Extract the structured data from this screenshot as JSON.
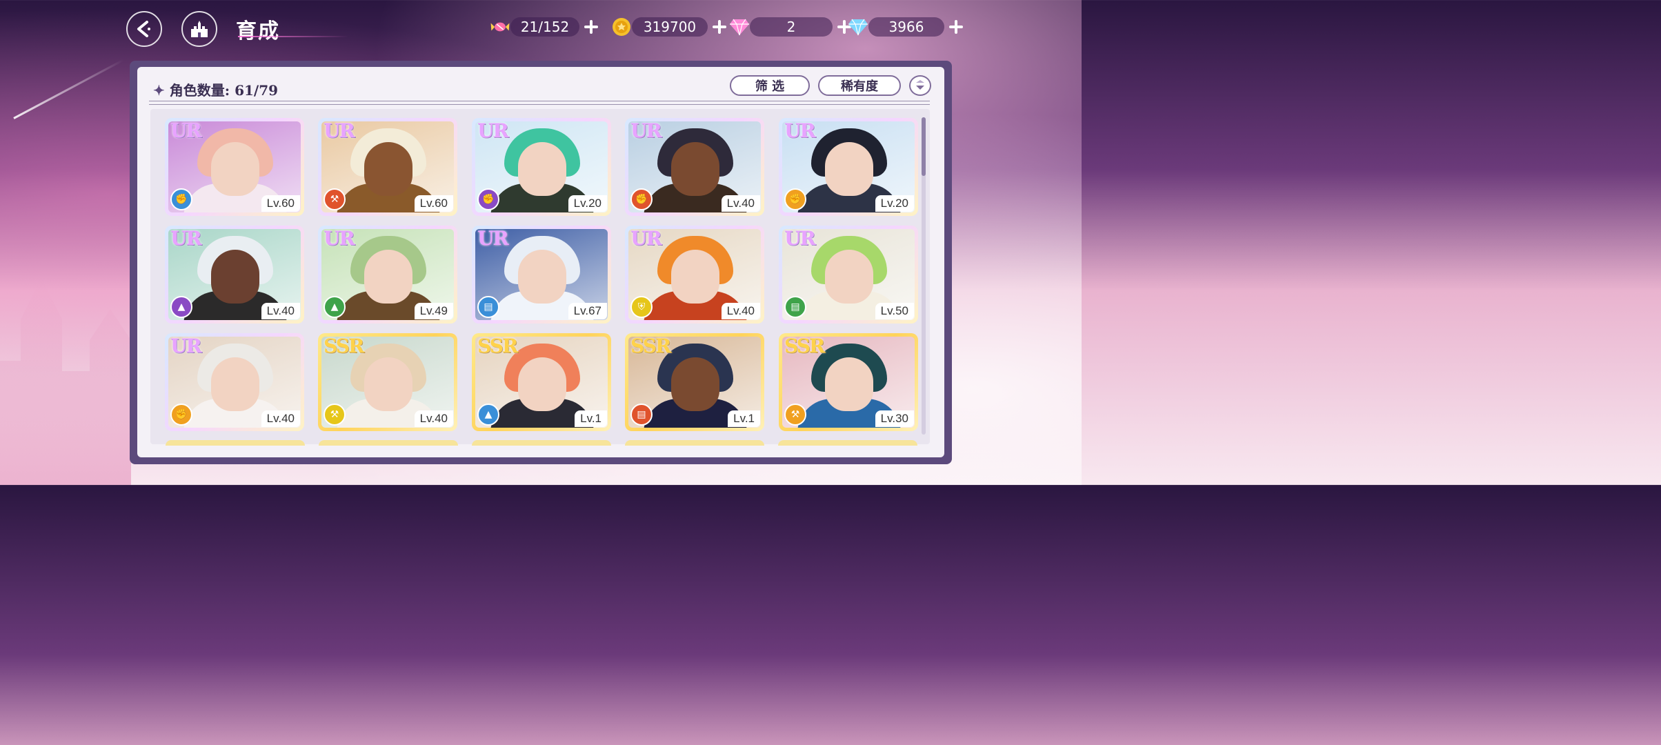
{
  "header": {
    "title": "育成",
    "back_icon": "back-arrow-icon",
    "home_icon": "castle-icon"
  },
  "resources": [
    {
      "name": "candy",
      "icon": "candy-icon",
      "value": "21/152",
      "color": "#ff6fa8"
    },
    {
      "name": "gold",
      "icon": "gold-coin-icon",
      "value": "319700",
      "color": "#f6c12b"
    },
    {
      "name": "gem-pink",
      "icon": "pink-diamond-icon",
      "value": "2",
      "color": "#ff7fd6"
    },
    {
      "name": "gem-blue",
      "icon": "blue-diamond-icon",
      "value": "3966",
      "color": "#7fd8ff"
    }
  ],
  "panel": {
    "count_label": "角色数量: 61/79",
    "filter_label": "筛 选",
    "rarity_label": "稀有度"
  },
  "attr_colors": {
    "blue": "#3a8fd8",
    "red": "#e0532c",
    "purple": "#8a4ac4",
    "orange": "#f0a020",
    "green": "#3fa34a",
    "yellow": "#e6c619"
  },
  "cards": [
    {
      "rank": "UR",
      "level": "Lv.60",
      "attr": "blue",
      "attr_icon": "fist-icon",
      "hair": "#f1b8a8",
      "bg": "#c98ad8",
      "outfit": "#f4e8f0"
    },
    {
      "rank": "UR",
      "level": "Lv.60",
      "attr": "red",
      "attr_icon": "hammer-icon",
      "hair": "#f3ecd8",
      "bg": "#e9c9a2",
      "outfit": "#8a5a2a",
      "skin": "#8a5531"
    },
    {
      "rank": "UR",
      "level": "Lv.20",
      "attr": "purple",
      "attr_icon": "fist-icon",
      "hair": "#3fc4a0",
      "bg": "#cfe6f4",
      "outfit": "#2f3a2f"
    },
    {
      "rank": "UR",
      "level": "Lv.40",
      "attr": "red",
      "attr_icon": "fist-icon",
      "hair": "#2e2a3a",
      "bg": "#b9cfe2",
      "outfit": "#3a2a20",
      "skin": "#7a4a30"
    },
    {
      "rank": "UR",
      "level": "Lv.20",
      "attr": "orange",
      "attr_icon": "fist-icon",
      "hair": "#1f2230",
      "bg": "#c8dff2",
      "outfit": "#2d3346"
    },
    {
      "rank": "UR",
      "level": "Lv.40",
      "attr": "purple",
      "attr_icon": "boot-icon",
      "hair": "#e9eef2",
      "bg": "#a9d6c8",
      "outfit": "#2b2a2a",
      "skin": "#6b4030"
    },
    {
      "rank": "UR",
      "level": "Lv.49",
      "attr": "green",
      "attr_icon": "boot-icon",
      "hair": "#a6c88a",
      "bg": "#c6e2b8",
      "outfit": "#6a4a2a"
    },
    {
      "rank": "UR",
      "level": "Lv.67",
      "attr": "blue",
      "attr_icon": "book-icon",
      "hair": "#e8eef6",
      "bg": "#3f5fa6",
      "outfit": "#f0f4fa"
    },
    {
      "rank": "UR",
      "level": "Lv.40",
      "attr": "yellow",
      "attr_icon": "shield-icon",
      "hair": "#f08a2a",
      "bg": "#e6d8c4",
      "outfit": "#c7421f"
    },
    {
      "rank": "UR",
      "level": "Lv.50",
      "attr": "green",
      "attr_icon": "book-icon",
      "hair": "#a7d86a",
      "bg": "#e8e4d8",
      "outfit": "#f4efe2"
    },
    {
      "rank": "UR",
      "level": "Lv.40",
      "attr": "orange",
      "attr_icon": "fist-icon",
      "hair": "#eceae6",
      "bg": "#e4d4c4",
      "outfit": "#f6f2f0"
    },
    {
      "rank": "SSR",
      "level": "Lv.40",
      "attr": "yellow",
      "attr_icon": "hammer-icon",
      "hair": "#e7d2b4",
      "bg": "#c8d8cc",
      "outfit": "#f4f0ea"
    },
    {
      "rank": "SSR",
      "level": "Lv.1",
      "attr": "blue",
      "attr_icon": "boot-icon",
      "hair": "#f0805a",
      "bg": "#e6d4c0",
      "outfit": "#2a2a34"
    },
    {
      "rank": "SSR",
      "level": "Lv.1",
      "attr": "red",
      "attr_icon": "book-icon",
      "hair": "#2a3450",
      "bg": "#d8b898",
      "outfit": "#1e2040",
      "skin": "#7a4a30"
    },
    {
      "rank": "SSR",
      "level": "Lv.30",
      "attr": "orange",
      "attr_icon": "hammer-icon",
      "hair": "#1e4a50",
      "bg": "#e6b8c0",
      "outfit": "#2a6aa8"
    }
  ]
}
